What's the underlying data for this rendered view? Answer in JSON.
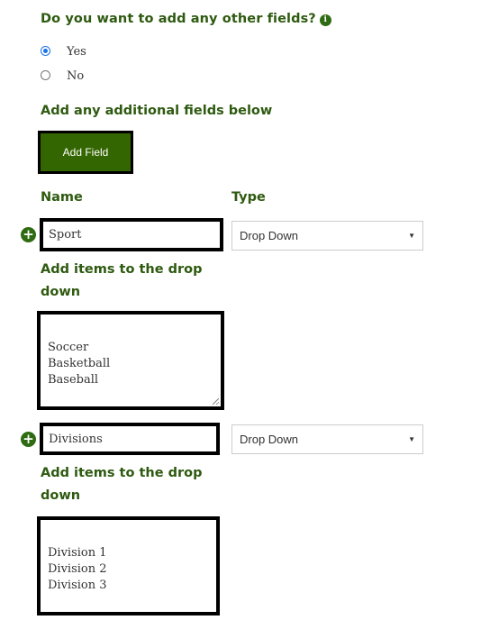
{
  "question": {
    "title": "Do you want to add any other fields?",
    "info_icon": "i"
  },
  "radio": {
    "yes_label": "Yes",
    "no_label": "No",
    "selected": "Yes"
  },
  "additional": {
    "title": "Add any additional fields below",
    "add_button": "Add Field"
  },
  "columns": {
    "name": "Name",
    "type": "Type"
  },
  "fields": [
    {
      "name": "Sport",
      "type": "Drop Down",
      "items_label": "Add items to the drop down",
      "items": "Soccer\nBasketball\nBaseball"
    },
    {
      "name": "Divisions",
      "type": "Drop Down",
      "items_label": "Add items to the drop down",
      "items": "Division 1\nDivision 2\nDivision 3"
    }
  ],
  "icons": {
    "plus": "+",
    "caret": "▼"
  },
  "colors": {
    "heading_green": "#2e5a10",
    "button_green": "#336600",
    "radio_blue": "#1a73e8"
  }
}
